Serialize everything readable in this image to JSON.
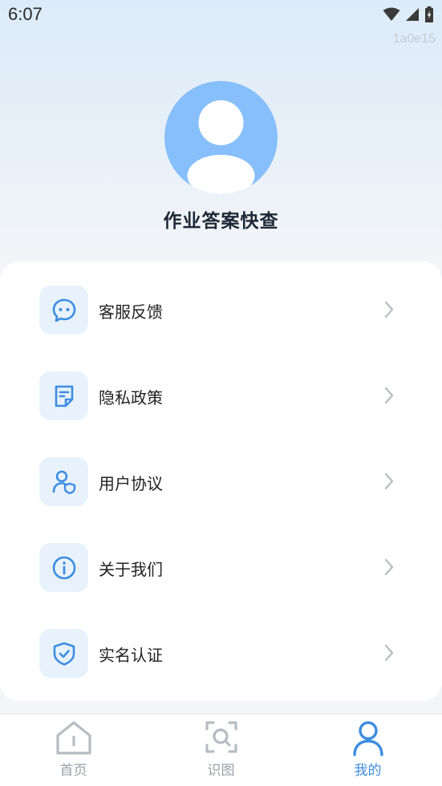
{
  "status_bar": {
    "time": "6:07"
  },
  "version_tag": "1a0e15",
  "profile": {
    "app_name": "作业答案快查"
  },
  "menu": {
    "items": [
      {
        "label": "客服反馈",
        "icon": "chat-bubble-icon"
      },
      {
        "label": "隐私政策",
        "icon": "document-icon"
      },
      {
        "label": "用户协议",
        "icon": "user-shield-icon"
      },
      {
        "label": "关于我们",
        "icon": "info-icon"
      },
      {
        "label": "实名认证",
        "icon": "shield-check-icon"
      }
    ]
  },
  "tab_bar": {
    "tabs": [
      {
        "label": "首页",
        "icon": "home-icon",
        "active": false
      },
      {
        "label": "识图",
        "icon": "scan-search-icon",
        "active": false
      },
      {
        "label": "我的",
        "icon": "person-icon",
        "active": true
      }
    ]
  },
  "colors": {
    "accent": "#3d8de0",
    "avatar_bg": "#86bffb",
    "icon_bg": "#e7f2fd"
  }
}
